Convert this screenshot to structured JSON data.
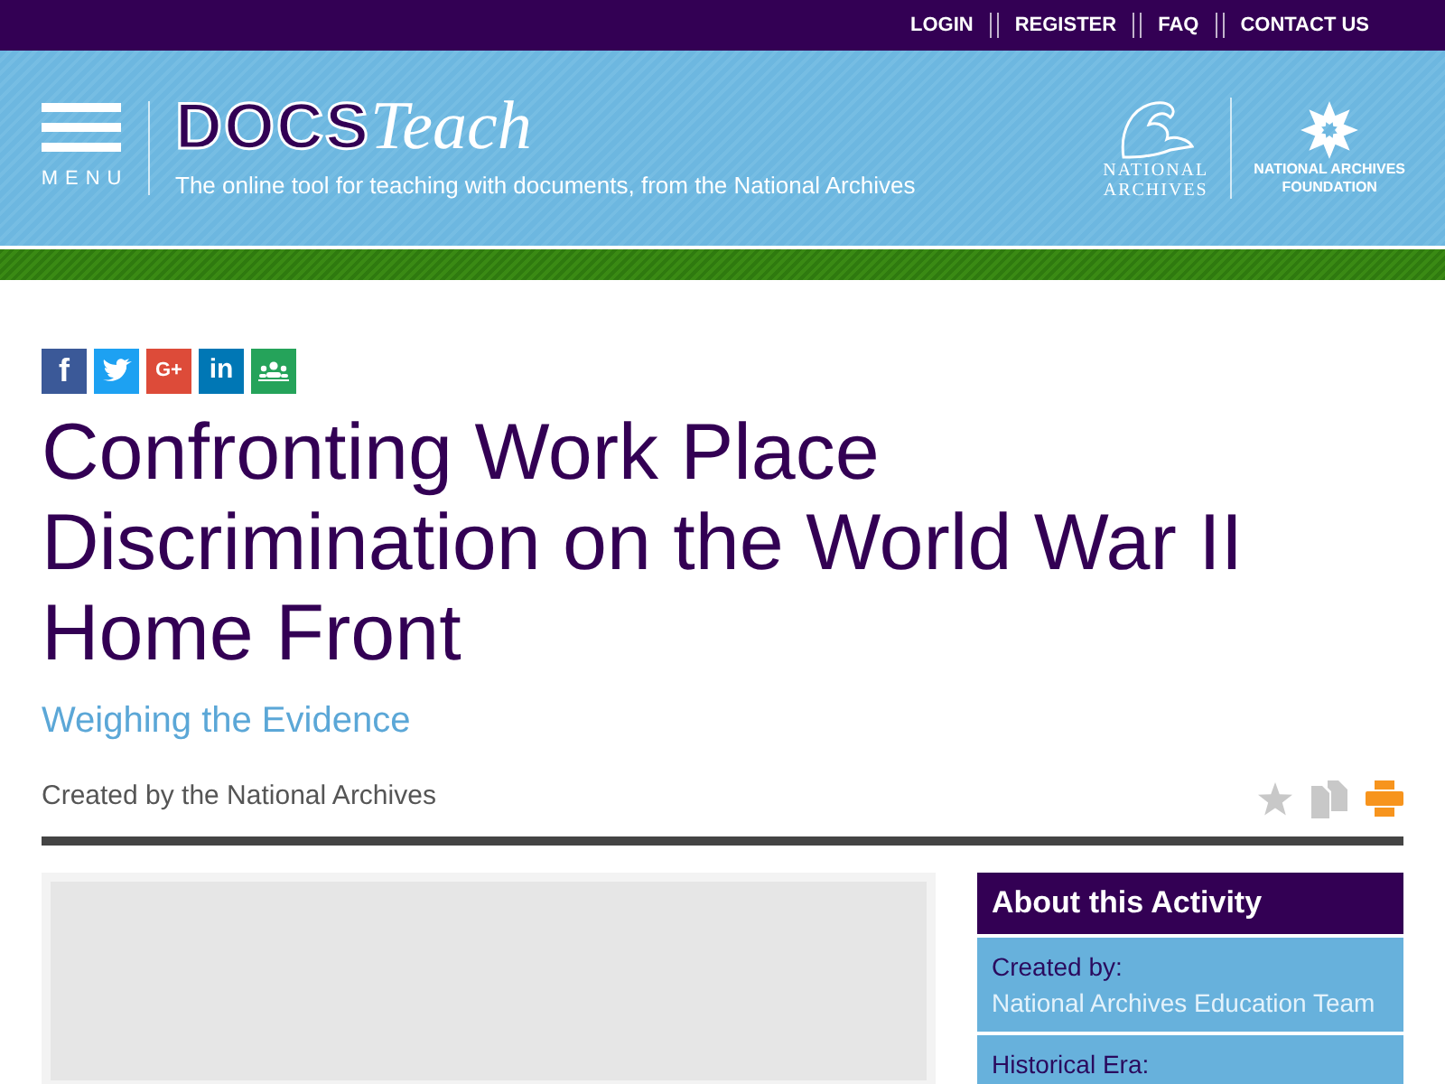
{
  "top_nav": {
    "links": [
      "LOGIN",
      "REGISTER",
      "FAQ",
      "CONTACT US"
    ]
  },
  "header": {
    "menu_label": "MENU",
    "logo": {
      "bold": "DOCS",
      "script": "Teach"
    },
    "tagline": "The online tool for teaching with documents, from the National Archives",
    "partner_logos": [
      {
        "kind": "archives",
        "lines": [
          "NATIONAL",
          "ARCHIVES"
        ]
      },
      {
        "kind": "foundation",
        "lines": [
          "NATIONAL ARCHIVES",
          "FOUNDATION"
        ]
      }
    ]
  },
  "share_buttons": [
    {
      "kind": "facebook",
      "label": "f",
      "color": "#3b5998"
    },
    {
      "kind": "twitter",
      "color": "#1da1f2"
    },
    {
      "kind": "googleplus",
      "label": "G+",
      "color": "#dd4b39"
    },
    {
      "kind": "linkedin",
      "label": "in",
      "color": "#0077b5"
    },
    {
      "kind": "classroom",
      "color": "#25a35a"
    }
  ],
  "title": "Confronting Work Place Discrimination on the World War II Home Front",
  "subtitle": "Weighing the Evidence",
  "byline": "Created by the National Archives",
  "actions": [
    {
      "kind": "favorite",
      "color": "#c8c8c8"
    },
    {
      "kind": "copy",
      "color": "#c8c8c8"
    },
    {
      "kind": "print",
      "color": "#f7941d"
    }
  ],
  "about": {
    "heading": "About this Activity",
    "fields": [
      {
        "label": "Created by:",
        "value": "National Archives Education Team"
      },
      {
        "label": "Historical Era:"
      }
    ]
  }
}
